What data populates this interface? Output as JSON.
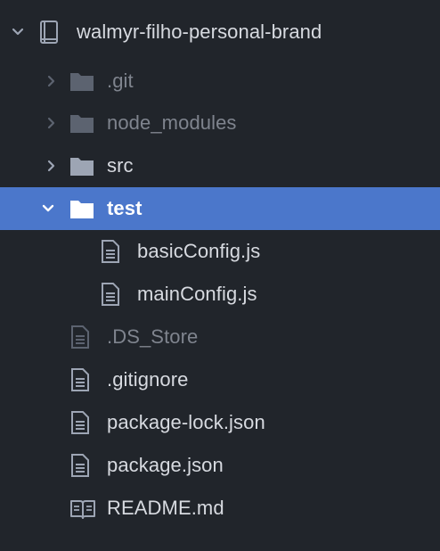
{
  "project": {
    "name": "walmyr-filho-personal-brand",
    "icon": "book-icon",
    "expanded": true
  },
  "entries": [
    {
      "label": ".git",
      "kind": "folder",
      "state": "collapsed",
      "dimmed": true
    },
    {
      "label": "node_modules",
      "kind": "folder",
      "state": "collapsed",
      "dimmed": true
    },
    {
      "label": "src",
      "kind": "folder",
      "state": "collapsed",
      "dimmed": false
    },
    {
      "label": "test",
      "kind": "folder",
      "state": "expanded",
      "selected": true
    },
    {
      "label": "basicConfig.js",
      "kind": "file",
      "parent": "test"
    },
    {
      "label": "mainConfig.js",
      "kind": "file",
      "parent": "test"
    },
    {
      "label": ".DS_Store",
      "kind": "file",
      "dimmed": true
    },
    {
      "label": ".gitignore",
      "kind": "file"
    },
    {
      "label": "package-lock.json",
      "kind": "file"
    },
    {
      "label": "package.json",
      "kind": "file"
    },
    {
      "label": "README.md",
      "kind": "readme",
      "icon": "book-open-icon"
    }
  ],
  "colors": {
    "background": "#21252b",
    "selection": "#4b77cb",
    "text": "#d7dae0",
    "dimmed_text": "#7f848e",
    "icon": "#9da5b4",
    "dimmed_icon": "#5c6370"
  }
}
